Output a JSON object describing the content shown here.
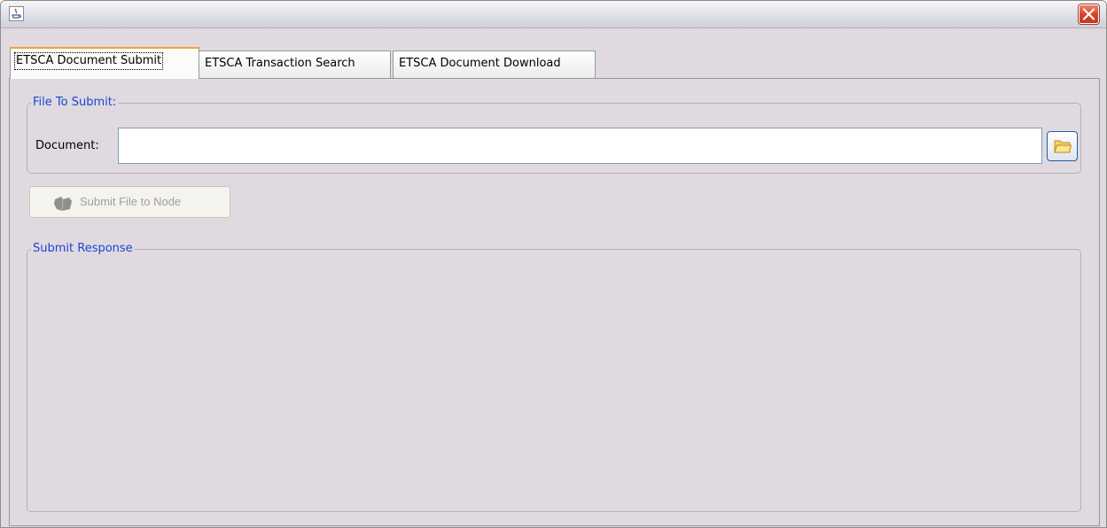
{
  "window": {
    "title": ""
  },
  "tabs": [
    {
      "label": "ETSCA Document Submit",
      "active": true
    },
    {
      "label": "ETSCA Transaction Search",
      "active": false
    },
    {
      "label": "ETSCA Document Download",
      "active": false
    }
  ],
  "file_group": {
    "title": "File To Submit:",
    "document_label": "Document:",
    "document_value": "",
    "browse_icon": "folder-icon"
  },
  "submit_button": {
    "label": "Submit File to Node",
    "enabled": false,
    "icon": "node-icon"
  },
  "response_group": {
    "title": "Submit Response",
    "content": ""
  },
  "colors": {
    "group_title": "#1a44d8",
    "panel_bg": "#e0dae0",
    "active_tab_accent": "#f0a52c",
    "close_button": "#d6452a"
  }
}
